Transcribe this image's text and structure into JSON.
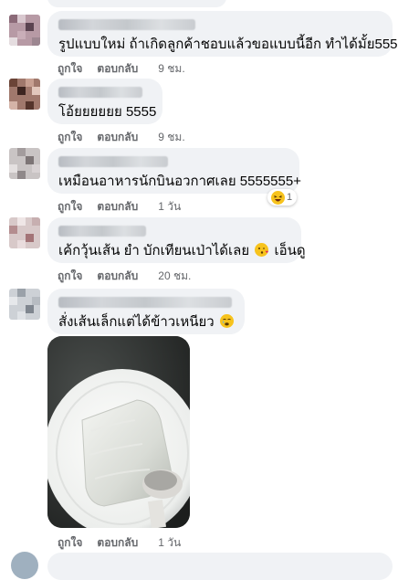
{
  "comments": [
    {
      "text": "รูปแบบใหม่ ถ้าเกิดลูกค้าชอบแล้วขอแบบนี้อีก ทำได้มั้ย5555",
      "like": "ถูกใจ",
      "reply": "ตอบกลับ",
      "time": "9 ชม."
    },
    {
      "text": "โอ้ยยยยยย 5555",
      "like": "ถูกใจ",
      "reply": "ตอบกลับ",
      "time": "9 ชม."
    },
    {
      "text": "เหมือนอาหารนักบินอวกาศเลย 5555555+",
      "like": "ถูกใจ",
      "reply": "ตอบกลับ",
      "time": "1 วัน",
      "reaction_count": "1"
    },
    {
      "text": "เค้กวุ้นเส้น ยำ บักเทียนเป่าได้เลย",
      "text_tail": "เอ็นดู",
      "like": "ถูกใจ",
      "reply": "ตอบกลับ",
      "time": "20 ชม."
    },
    {
      "text": "สั่งเส้นเล็กแต่ได้ข้าวเหนียว",
      "like": "ถูกใจ",
      "reply": "ตอบกลับ",
      "time": "1 วัน"
    }
  ],
  "colors": {
    "bubble": "#f0f2f5",
    "meta_text": "#65676b",
    "emoji": "#f7c31d"
  },
  "icons": [
    "laughing-emoji-icon",
    "kiss-emoji-icon",
    "crying-emoji-icon"
  ]
}
